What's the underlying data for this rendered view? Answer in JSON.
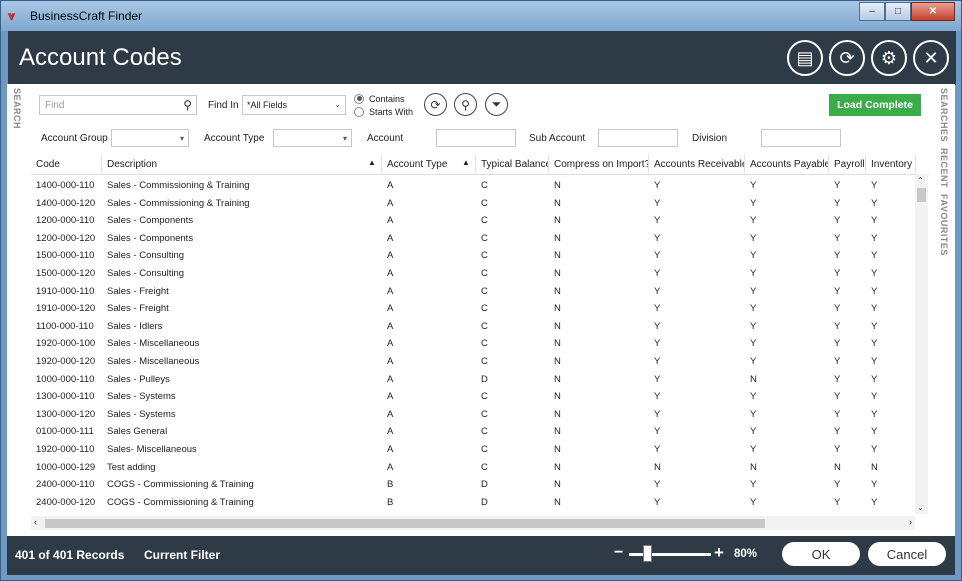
{
  "window": {
    "app_title": "BusinessCraft Finder",
    "minimize_glyph": "‒",
    "maximize_glyph": "□",
    "close_glyph": "✕"
  },
  "header": {
    "title": "Account Codes",
    "icons": [
      "calendar-icon",
      "refresh-icon",
      "gear-icon",
      "close-icon"
    ],
    "icon_glyphs": [
      "▤",
      "⟳",
      "⚙",
      "✕"
    ]
  },
  "side_tabs": {
    "left": "SEARCH",
    "right": [
      "SEARCHES",
      "RECENT",
      "FAVOURITES"
    ]
  },
  "toolbar": {
    "find_placeholder": "Find",
    "find_icon_glyph": "⚲",
    "find_in_label": "Find In",
    "find_in_value": "*All Fields",
    "radio_contains": "Contains",
    "radio_starts_with": "Starts With",
    "selected_radio": "Contains",
    "refresh_glyph": "⟳",
    "search_glyph": "⚲",
    "filter_glyph": "⏷",
    "load_button": "Load Complete"
  },
  "filters": {
    "account_group_label": "Account Group",
    "account_type_label": "Account Type",
    "account_label": "Account",
    "sub_account_label": "Sub Account",
    "division_label": "Division"
  },
  "grid": {
    "columns": [
      "Code",
      "Description",
      "Account Type",
      "Typical Balance",
      "Compress on Import?",
      "Accounts Receivable",
      "Accounts Payable",
      "Payroll",
      "Inventory"
    ],
    "sort_glyph": "▲",
    "rows": [
      [
        "1400-000-110",
        "Sales - Commissioning & Training",
        "A",
        "C",
        "N",
        "Y",
        "Y",
        "Y",
        "Y"
      ],
      [
        "1400-000-120",
        "Sales - Commissioning & Training",
        "A",
        "C",
        "N",
        "Y",
        "Y",
        "Y",
        "Y"
      ],
      [
        "1200-000-110",
        "Sales - Components",
        "A",
        "C",
        "N",
        "Y",
        "Y",
        "Y",
        "Y"
      ],
      [
        "1200-000-120",
        "Sales - Components",
        "A",
        "C",
        "N",
        "Y",
        "Y",
        "Y",
        "Y"
      ],
      [
        "1500-000-110",
        "Sales - Consulting",
        "A",
        "C",
        "N",
        "Y",
        "Y",
        "Y",
        "Y"
      ],
      [
        "1500-000-120",
        "Sales - Consulting",
        "A",
        "C",
        "N",
        "Y",
        "Y",
        "Y",
        "Y"
      ],
      [
        "1910-000-110",
        "Sales - Freight",
        "A",
        "C",
        "N",
        "Y",
        "Y",
        "Y",
        "Y"
      ],
      [
        "1910-000-120",
        "Sales - Freight",
        "A",
        "C",
        "N",
        "Y",
        "Y",
        "Y",
        "Y"
      ],
      [
        "1100-000-110",
        "Sales - Idlers",
        "A",
        "C",
        "N",
        "Y",
        "Y",
        "Y",
        "Y"
      ],
      [
        "1920-000-100",
        "Sales - Miscellaneous",
        "A",
        "C",
        "N",
        "Y",
        "Y",
        "Y",
        "Y"
      ],
      [
        "1920-000-120",
        "Sales - Miscellaneous",
        "A",
        "C",
        "N",
        "Y",
        "Y",
        "Y",
        "Y"
      ],
      [
        "1000-000-110",
        "Sales - Pulleys",
        "A",
        "D",
        "N",
        "Y",
        "N",
        "Y",
        "Y"
      ],
      [
        "1300-000-110",
        "Sales - Systems",
        "A",
        "C",
        "N",
        "Y",
        "Y",
        "Y",
        "Y"
      ],
      [
        "1300-000-120",
        "Sales - Systems",
        "A",
        "C",
        "N",
        "Y",
        "Y",
        "Y",
        "Y"
      ],
      [
        "0100-000-111",
        "Sales General",
        "A",
        "C",
        "N",
        "Y",
        "Y",
        "Y",
        "Y"
      ],
      [
        "1920-000-110",
        "Sales- Miscellaneous",
        "A",
        "C",
        "N",
        "Y",
        "Y",
        "Y",
        "Y"
      ],
      [
        "1000-000-129",
        "Test adding",
        "A",
        "C",
        "N",
        "N",
        "N",
        "N",
        "N"
      ],
      [
        "2400-000-110",
        "COGS - Commissioning & Training",
        "B",
        "D",
        "N",
        "Y",
        "Y",
        "Y",
        "Y"
      ],
      [
        "2400-000-120",
        "COGS - Commissioning & Training",
        "B",
        "D",
        "N",
        "Y",
        "Y",
        "Y",
        "Y"
      ]
    ]
  },
  "footer": {
    "records": "401 of 401 Records",
    "filter_label": "Current Filter",
    "zoom_minus": "−",
    "zoom_plus": "+",
    "zoom": "80%",
    "zoom_level": 0.22,
    "ok_button": "OK",
    "cancel_button": "Cancel"
  },
  "colors": {
    "header_bg": "#2f3a47",
    "accent_green": "#3aad4a",
    "window_frame": "#6d9ac4"
  }
}
